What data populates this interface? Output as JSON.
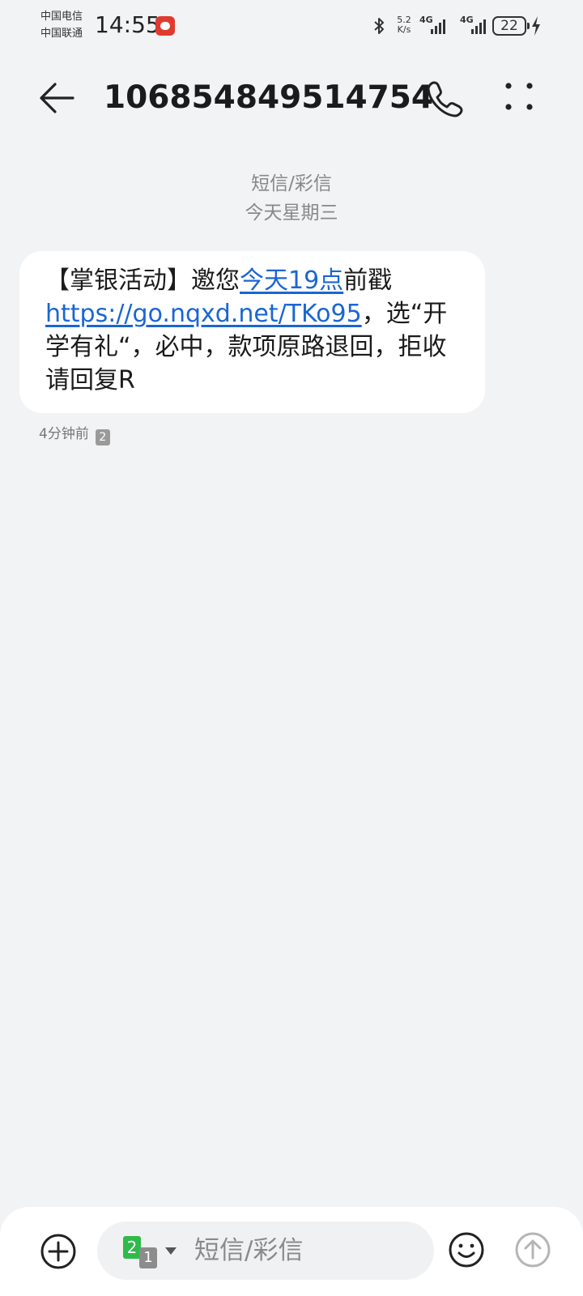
{
  "status_bar": {
    "carrier_1": "中国电信",
    "carrier_2": "中国联通",
    "time": "14:55",
    "net_speed_value": "5.2",
    "net_speed_unit": "K/s",
    "signal_1_label": "4G",
    "signal_2_label": "4G",
    "battery_level": "22"
  },
  "header": {
    "contact_number": "106854849514754"
  },
  "thread": {
    "message_type": "短信/彩信",
    "date_label": "今天星期三"
  },
  "message": {
    "part_1": "【掌银活动】邀您",
    "link_time": "今天19点",
    "part_2": "前戳",
    "link_url": "https://go.nqxd.net/TKo95",
    "part_3": "，选“开学有礼“，必中，款项原路退回，拒收请回复R",
    "time_ago": "4分钟前",
    "sim_slot": "2"
  },
  "composer": {
    "placeholder": "短信/彩信",
    "sim_primary": "2",
    "sim_secondary": "1"
  },
  "colors": {
    "background": "#f1f3f5",
    "link": "#1a66d4",
    "sim_active": "#2fba4a"
  },
  "icons": [
    "bluetooth-icon",
    "back-arrow-icon",
    "phone-icon",
    "more-dots-icon",
    "plus-icon",
    "emoji-icon",
    "send-icon"
  ]
}
